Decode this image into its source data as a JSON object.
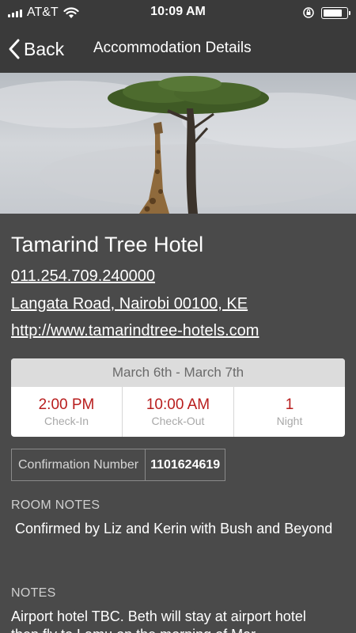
{
  "status_bar": {
    "carrier": "AT&T",
    "time": "10:09 AM",
    "battery_level": 0.85
  },
  "nav": {
    "back_label": "Back",
    "title": "Accommodation Details"
  },
  "hotel": {
    "name": "Tamarind Tree Hotel",
    "phone": "011.254.709.240000",
    "address": "Langata Road, Nairobi 00100, KE",
    "website": "http://www.tamarindtree-hotels.com"
  },
  "stay": {
    "date_range": "March 6th - March 7th",
    "check_in": {
      "value": "2:00 PM",
      "label": "Check-In"
    },
    "check_out": {
      "value": "10:00 AM",
      "label": "Check-Out"
    },
    "nights": {
      "value": "1",
      "label": "Night"
    }
  },
  "confirmation": {
    "label": "Confirmation Number",
    "value": "1101624619"
  },
  "room_notes": {
    "title": "ROOM NOTES",
    "text": " Confirmed by Liz and Kerin with Bush and Beyond"
  },
  "notes": {
    "title": "NOTES",
    "text": "Airport hotel TBC. Beth will stay at airport hotel then fly to Lamu on the morning of Mar"
  },
  "colors": {
    "header_bg": "#3a3a3a",
    "content_bg": "#4a4a4a",
    "accent_red": "#b81d1d"
  },
  "icons": {
    "signal": "signal-bars-icon",
    "wifi": "wifi-icon",
    "orientation_lock": "orientation-lock-icon",
    "battery": "battery-icon",
    "back": "chevron-left-icon"
  }
}
